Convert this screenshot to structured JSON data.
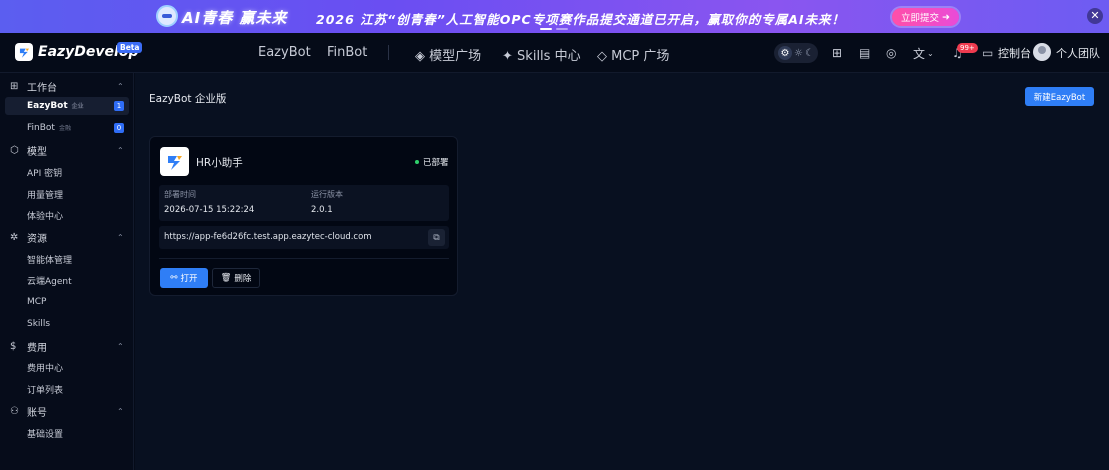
{
  "banner": {
    "brand": "AI青春 赢未来",
    "headline": "2026 江苏“创青春”人工智能OPC专项赛作品提交通道已开启，赢取你的专属AI未来！",
    "cta_label": "立即提交",
    "cta_icon": "arrow-right-circle-icon",
    "close_icon": "close-icon"
  },
  "topnav": {
    "logo_text": "EazyDevelop",
    "beta_label": "Beta",
    "primary_links": [
      "EazyBot",
      "FinBot"
    ],
    "secondary_links": [
      {
        "icon": "◈",
        "label": "模型广场"
      },
      {
        "icon": "✦",
        "label": "Skills 中心"
      },
      {
        "icon": "◇",
        "label": "MCP 广场"
      }
    ],
    "notification_badge": "99+",
    "console_label": "控制台",
    "team_label": "个人团队",
    "translate_chevron": "⌄"
  },
  "sidebar": {
    "groups": [
      {
        "label": "工作台",
        "icon": "grid-icon",
        "glyph": "⊞",
        "chevron": "⌃",
        "items": [
          {
            "label": "EazyBot",
            "tag": "企业",
            "count": "1",
            "active": true
          },
          {
            "label": "FinBot",
            "tag": "金融",
            "count": "0",
            "active": false
          }
        ]
      },
      {
        "label": "模型",
        "icon": "cube-icon",
        "glyph": "⬡",
        "chevron": "⌃",
        "items": [
          {
            "label": "API 密钥"
          },
          {
            "label": "用量管理"
          },
          {
            "label": "体验中心"
          }
        ]
      },
      {
        "label": "资源",
        "icon": "gear-icon",
        "glyph": "✲",
        "chevron": "⌃",
        "items": [
          {
            "label": "智能体管理"
          },
          {
            "label": "云端Agent"
          },
          {
            "label": "MCP"
          },
          {
            "label": "Skills"
          }
        ]
      },
      {
        "label": "费用",
        "icon": "dollar-icon",
        "glyph": "$",
        "chevron": "⌃",
        "items": [
          {
            "label": "费用中心"
          },
          {
            "label": "订单列表"
          }
        ]
      },
      {
        "label": "账号",
        "icon": "user-icon",
        "glyph": "⚇",
        "chevron": "⌃",
        "items": [
          {
            "label": "基础设置"
          }
        ]
      }
    ]
  },
  "main": {
    "title": "EazyBot 企业版",
    "new_button_label": "新建EazyBot",
    "card": {
      "name": "HR小助手",
      "status": "已部署",
      "deploy_time_label": "部署时间",
      "deploy_time": "2026-07-15 15:22:24",
      "version_label": "运行版本",
      "version": "2.0.1",
      "url": "https://app-fe6d26fc.test.app.eazytec-cloud.com",
      "open_label": "打开",
      "delete_label": "删除"
    }
  },
  "colors": {
    "accent": "#2f7ef6",
    "status_green": "#2fd06b",
    "badge_red": "#ef3b4f",
    "banner_purple": "#6a4ef2"
  }
}
